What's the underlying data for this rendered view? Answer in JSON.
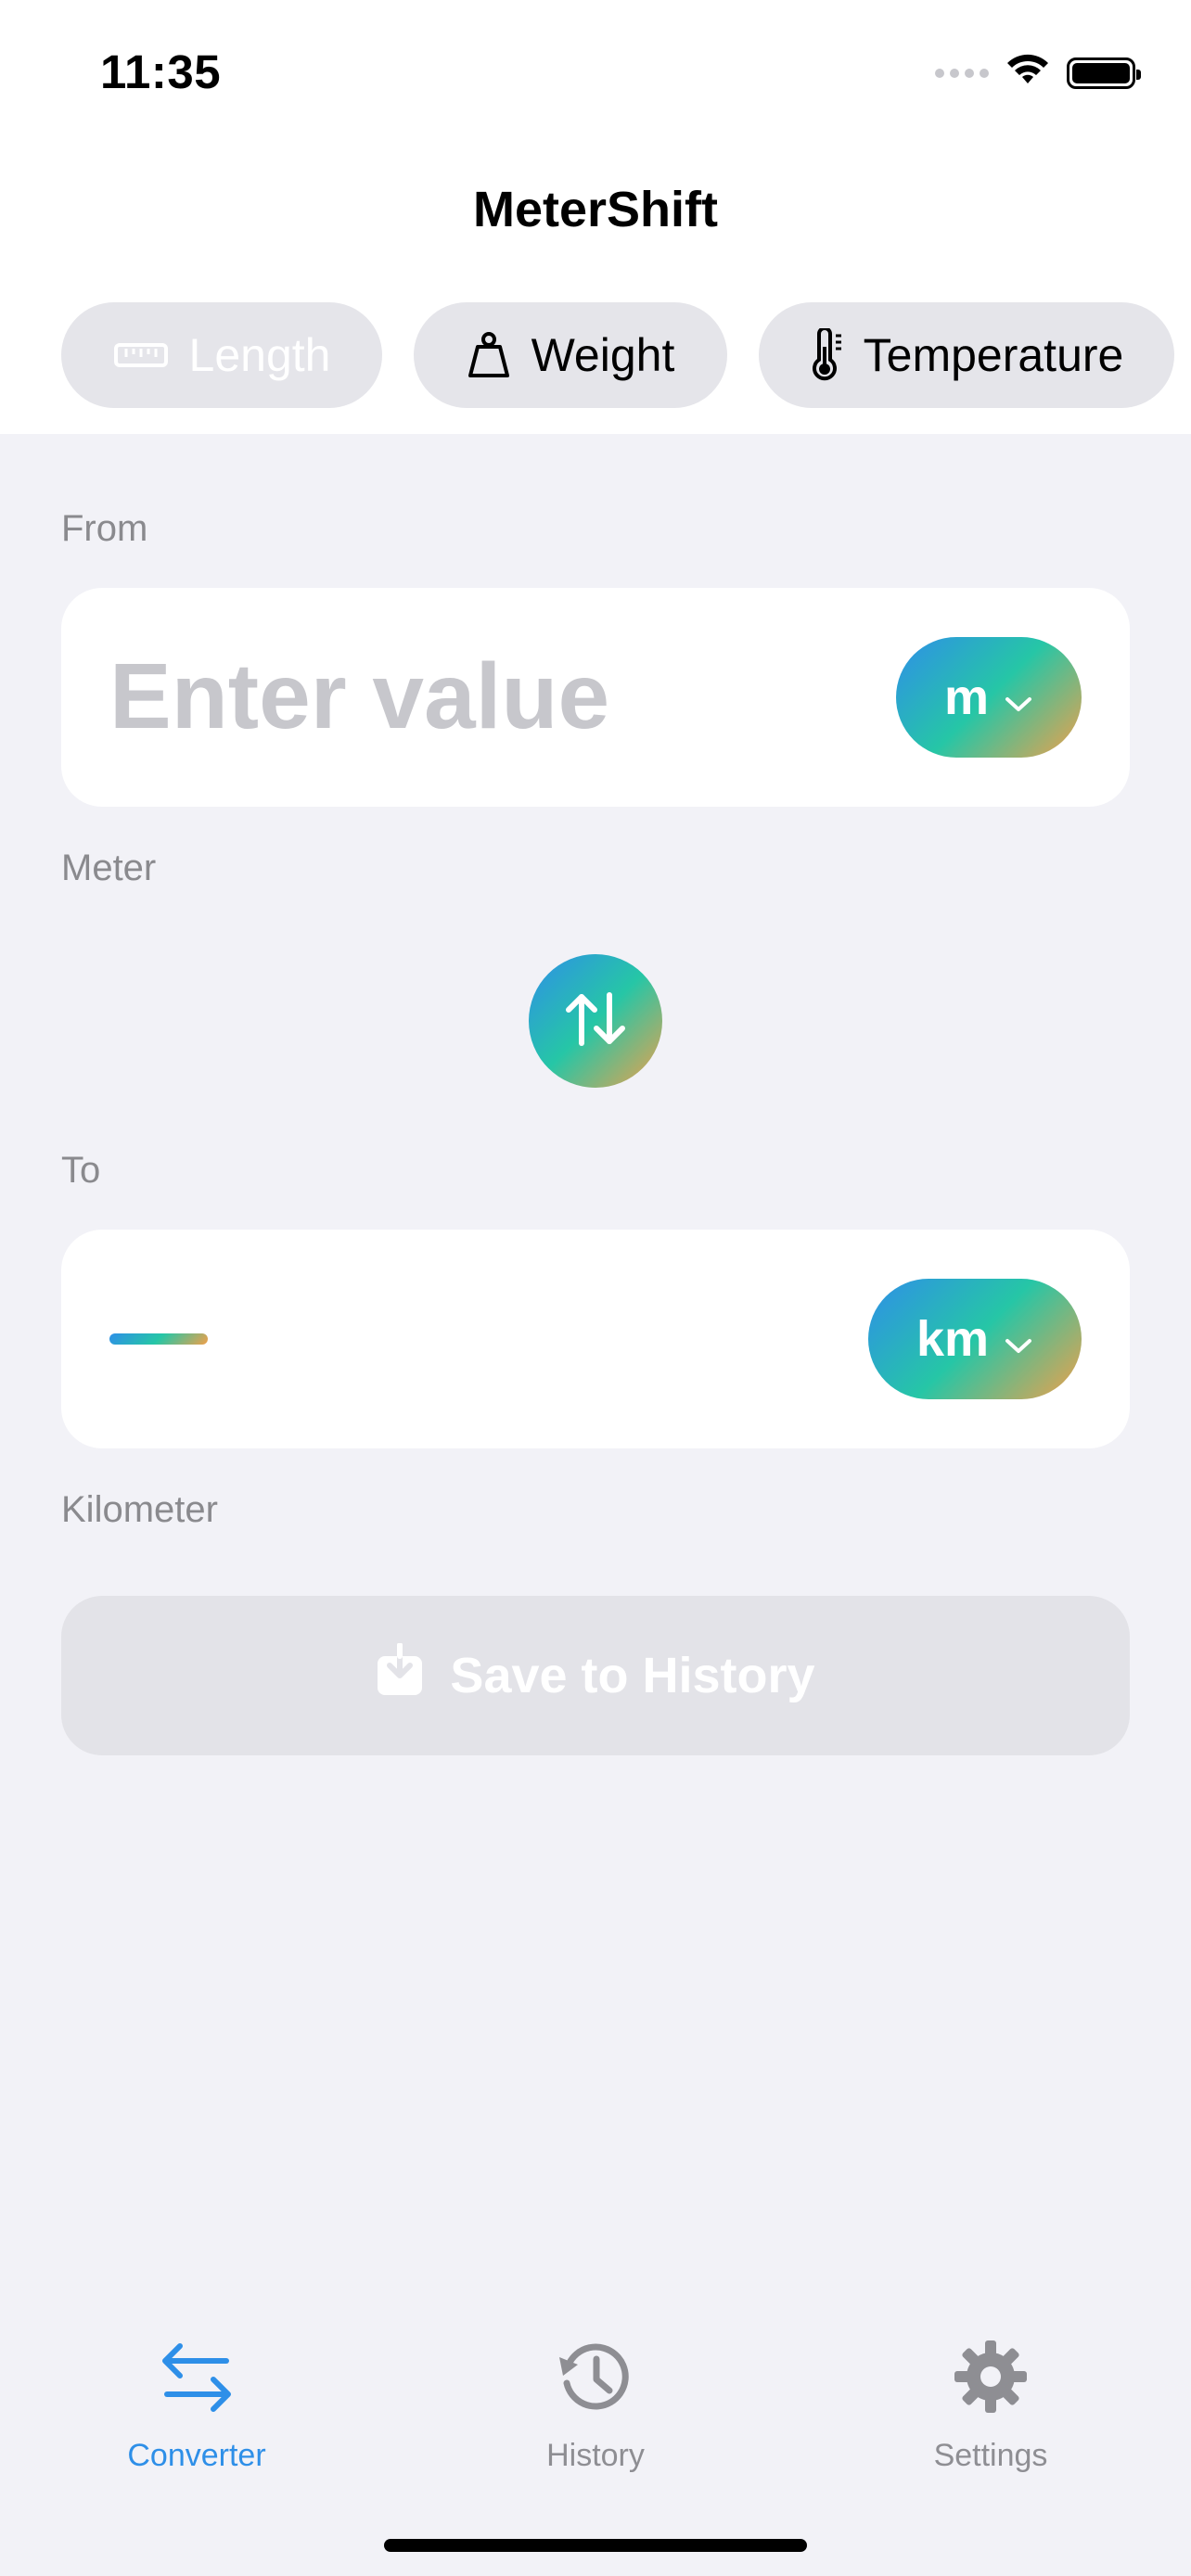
{
  "status_bar": {
    "time": "11:35"
  },
  "app": {
    "title": "MeterShift"
  },
  "category_tabs": [
    {
      "label": "Length",
      "icon": "ruler-icon",
      "selected": true
    },
    {
      "label": "Weight",
      "icon": "weight-icon",
      "selected": false
    },
    {
      "label": "Temperature",
      "icon": "thermometer-icon",
      "selected": false
    }
  ],
  "from": {
    "section_label": "From",
    "placeholder": "Enter value",
    "unit_symbol": "m",
    "unit_name": "Meter"
  },
  "to": {
    "section_label": "To",
    "unit_symbol": "km",
    "unit_name": "Kilometer"
  },
  "actions": {
    "save_label": "Save to History",
    "save_enabled": false
  },
  "tab_bar": [
    {
      "label": "Converter",
      "icon": "arrows-exchange-icon",
      "active": true
    },
    {
      "label": "History",
      "icon": "clock-history-icon",
      "active": false
    },
    {
      "label": "Settings",
      "icon": "gear-icon",
      "active": false
    }
  ],
  "colors": {
    "accent_blue": "#2E8FE8",
    "accent_teal": "#26C6A6",
    "accent_orange": "#F0A04A",
    "background": "#F2F2F7",
    "inactive_gray": "#8E8E93"
  }
}
